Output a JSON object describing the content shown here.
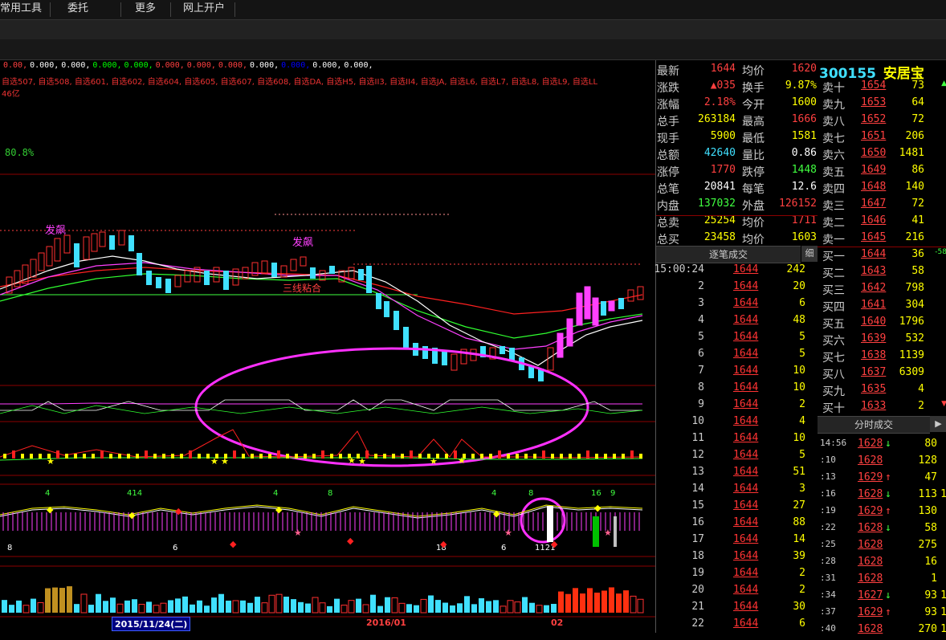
{
  "menu": [
    "常用工具",
    "委托",
    "更多",
    "网上开户"
  ],
  "chart": {
    "indicator_values": [
      {
        "text": "0.00,",
        "color": "#ff4040"
      },
      {
        "text": "0.000,",
        "color": "#ffffff"
      },
      {
        "text": "0.000,",
        "color": "#ffffff"
      },
      {
        "text": "0.000,",
        "color": "#00ff00"
      },
      {
        "text": "0.000,",
        "color": "#00ff00"
      },
      {
        "text": "0.000,",
        "color": "#ff4040"
      },
      {
        "text": "0.000,",
        "color": "#ff4040"
      },
      {
        "text": "0.000,",
        "color": "#ff4040"
      },
      {
        "text": "0.000,",
        "color": "#ffffff"
      },
      {
        "text": "0.000,",
        "color": "#0000ff"
      },
      {
        "text": "0.000,",
        "color": "#ffffff"
      },
      {
        "text": "0.000,",
        "color": "#ffffff"
      }
    ],
    "selection_labels": "自选507, 自选508, 自选601, 自选602, 自选604, 自选605, 自选607, 自选608, 自选DA, 自选H5, 自选II3, 自选II4, 自选JA, 自选L6, 自选L7, 自选L8, 自选L9, 自选LL",
    "amount": "46亿",
    "percent": "80.8%",
    "dates": [
      {
        "text": "2015/11/24(二)",
        "color": "#ffffff",
        "bg": "#000080"
      },
      {
        "text": "2016/01",
        "color": "#ff4040",
        "bg": "none"
      },
      {
        "text": "02",
        "color": "#ff4040",
        "bg": "none"
      }
    ],
    "annotations": {
      "fa_biao_1": "发飙",
      "fa_biao_2": "发飙",
      "san_xian": "三线粘合"
    }
  },
  "quote": {
    "rows": [
      {
        "l1": "最新",
        "v1": "1644",
        "c1": "#ff4040",
        "l2": "均价",
        "v2": "1620",
        "c2": "#ff4040"
      },
      {
        "l1": "涨跌",
        "v1": "▲035",
        "c1": "#ff4040",
        "l2": "换手",
        "v2": "9.87%",
        "c2": "#ffff00"
      },
      {
        "l1": "涨幅",
        "v1": "2.18%",
        "c1": "#ff4040",
        "l2": "今开",
        "v2": "1600",
        "c2": "#ffff00"
      },
      {
        "l1": "总手",
        "v1": "263184",
        "c1": "#ffff00",
        "l2": "最高",
        "v2": "1666",
        "c2": "#ff4040"
      },
      {
        "l1": "现手",
        "v1": "5900",
        "c1": "#ffff00",
        "l2": "最低",
        "v2": "1581",
        "c2": "#ffff00"
      },
      {
        "l1": "总额",
        "v1": "42640",
        "c1": "#40e0ff",
        "l2": "量比",
        "v2": "0.86",
        "c2": "#ffffff"
      },
      {
        "l1": "涨停",
        "v1": "1770",
        "c1": "#ff4040",
        "l2": "跌停",
        "v2": "1448",
        "c2": "#40ff40"
      },
      {
        "l1": "总笔",
        "v1": "20841",
        "c1": "#ffffff",
        "l2": "每笔",
        "v2": "12.6",
        "c2": "#ffffff"
      },
      {
        "l1": "内盘",
        "v1": "137032",
        "c1": "#40ff40",
        "l2": "外盘",
        "v2": "126152",
        "c2": "#ff4040"
      },
      {
        "l1": "总卖",
        "v1": "25254",
        "c1": "#ffff00",
        "l2": "均价",
        "v2": "1711",
        "c2": "#ff4040"
      },
      {
        "l1": "总买",
        "v1": "23458",
        "c1": "#ffff00",
        "l2": "均价",
        "v2": "1603",
        "c2": "#ffff00"
      }
    ]
  },
  "book": {
    "code": "300155",
    "name": "安居宝",
    "sells": [
      {
        "l": "卖十",
        "p": "1654",
        "v": "73",
        "x": "▲",
        "xc": "#40ff40"
      },
      {
        "l": "卖九",
        "p": "1653",
        "v": "64",
        "x": "",
        "xc": ""
      },
      {
        "l": "卖八",
        "p": "1652",
        "v": "72",
        "x": "",
        "xc": ""
      },
      {
        "l": "卖七",
        "p": "1651",
        "v": "206",
        "x": "",
        "xc": ""
      },
      {
        "l": "卖六",
        "p": "1650",
        "v": "1481",
        "x": "",
        "xc": ""
      },
      {
        "l": "卖五",
        "p": "1649",
        "v": "86",
        "x": "",
        "xc": ""
      },
      {
        "l": "卖四",
        "p": "1648",
        "v": "140",
        "x": "",
        "xc": ""
      },
      {
        "l": "卖三",
        "p": "1647",
        "v": "72",
        "x": "",
        "xc": ""
      },
      {
        "l": "卖二",
        "p": "1646",
        "v": "41",
        "x": "",
        "xc": ""
      },
      {
        "l": "卖一",
        "p": "1645",
        "v": "216",
        "x": "",
        "xc": ""
      }
    ],
    "buys": [
      {
        "l": "买一",
        "p": "1644",
        "v": "36",
        "x": "-58",
        "xc": "#40ff40"
      },
      {
        "l": "买二",
        "p": "1643",
        "v": "58",
        "x": "",
        "xc": ""
      },
      {
        "l": "买三",
        "p": "1642",
        "v": "798",
        "x": "",
        "xc": ""
      },
      {
        "l": "买四",
        "p": "1641",
        "v": "304",
        "x": "",
        "xc": ""
      },
      {
        "l": "买五",
        "p": "1640",
        "v": "1796",
        "x": "",
        "xc": ""
      },
      {
        "l": "买六",
        "p": "1639",
        "v": "532",
        "x": "",
        "xc": ""
      },
      {
        "l": "买七",
        "p": "1638",
        "v": "1139",
        "x": "",
        "xc": ""
      },
      {
        "l": "买八",
        "p": "1637",
        "v": "6309",
        "x": "",
        "xc": ""
      },
      {
        "l": "买九",
        "p": "1635",
        "v": "4",
        "x": "",
        "xc": ""
      },
      {
        "l": "买十",
        "p": "1633",
        "v": "2",
        "x": "▼",
        "xc": "#ff4040"
      }
    ]
  },
  "tabs": {
    "trades": "逐笔成交",
    "detail": "细",
    "minute": "分时成交",
    "arrow": "▶"
  },
  "ticks": [
    {
      "t": "15:00:24",
      "p": "1644",
      "v": "242"
    },
    {
      "t": "2",
      "p": "1644",
      "v": "20"
    },
    {
      "t": "3",
      "p": "1644",
      "v": "6"
    },
    {
      "t": "4",
      "p": "1644",
      "v": "48"
    },
    {
      "t": "5",
      "p": "1644",
      "v": "5"
    },
    {
      "t": "6",
      "p": "1644",
      "v": "5"
    },
    {
      "t": "7",
      "p": "1644",
      "v": "10"
    },
    {
      "t": "8",
      "p": "1644",
      "v": "10"
    },
    {
      "t": "9",
      "p": "1644",
      "v": "2"
    },
    {
      "t": "10",
      "p": "1644",
      "v": "4"
    },
    {
      "t": "11",
      "p": "1644",
      "v": "10"
    },
    {
      "t": "12",
      "p": "1644",
      "v": "5"
    },
    {
      "t": "13",
      "p": "1644",
      "v": "51"
    },
    {
      "t": "14",
      "p": "1644",
      "v": "3"
    },
    {
      "t": "15",
      "p": "1644",
      "v": "27"
    },
    {
      "t": "16",
      "p": "1644",
      "v": "88"
    },
    {
      "t": "17",
      "p": "1644",
      "v": "14"
    },
    {
      "t": "18",
      "p": "1644",
      "v": "39"
    },
    {
      "t": "19",
      "p": "1644",
      "v": "2"
    },
    {
      "t": "20",
      "p": "1644",
      "v": "2"
    },
    {
      "t": "21",
      "p": "1644",
      "v": "30"
    },
    {
      "t": "22",
      "p": "1644",
      "v": "6"
    }
  ],
  "mticks": [
    {
      "t": "14:56",
      "p": "1628",
      "a": "↓",
      "ac": "#40ff40",
      "pc": "#ff4040",
      "v": "80",
      "x": ""
    },
    {
      "t": ":10",
      "p": "1628",
      "a": "",
      "ac": "",
      "pc": "#ff4040",
      "v": "128",
      "x": ""
    },
    {
      "t": ":13",
      "p": "1629",
      "a": "↑",
      "ac": "#ff4040",
      "pc": "#ff4040",
      "v": "47",
      "x": ""
    },
    {
      "t": ":16",
      "p": "1628",
      "a": "↓",
      "ac": "#40ff40",
      "pc": "#ff4040",
      "v": "113",
      "x": "1"
    },
    {
      "t": ":19",
      "p": "1629",
      "a": "↑",
      "ac": "#ff4040",
      "pc": "#ff4040",
      "v": "130",
      "x": ""
    },
    {
      "t": ":22",
      "p": "1628",
      "a": "↓",
      "ac": "#40ff40",
      "pc": "#ff4040",
      "v": "58",
      "x": ""
    },
    {
      "t": ":25",
      "p": "1628",
      "a": "",
      "ac": "",
      "pc": "#ff4040",
      "v": "275",
      "x": ""
    },
    {
      "t": ":28",
      "p": "1628",
      "a": "",
      "ac": "",
      "pc": "#ff4040",
      "v": "16",
      "x": ""
    },
    {
      "t": ":31",
      "p": "1628",
      "a": "",
      "ac": "",
      "pc": "#ff4040",
      "v": "1",
      "x": ""
    },
    {
      "t": ":34",
      "p": "1627",
      "a": "↓",
      "ac": "#40ff40",
      "pc": "#ff4040",
      "v": "93",
      "x": "1"
    },
    {
      "t": ":37",
      "p": "1629",
      "a": "↑",
      "ac": "#ff4040",
      "pc": "#ff4040",
      "v": "93",
      "x": "1"
    },
    {
      "t": ":40",
      "p": "1628",
      "a": "",
      "ac": "",
      "pc": "#ff4040",
      "v": "270",
      "x": "1"
    }
  ]
}
